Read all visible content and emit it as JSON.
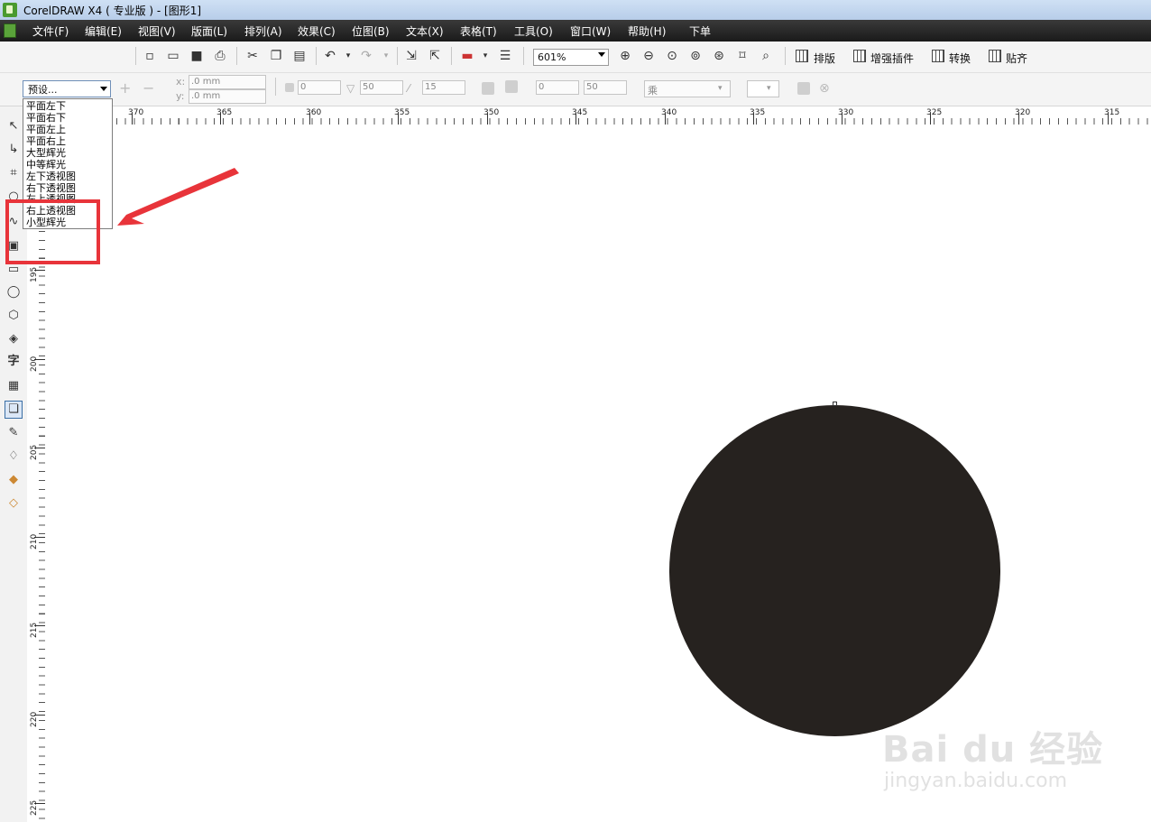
{
  "window": {
    "title": "CorelDRAW X4 ( 专业版 ) - [图形1]"
  },
  "menu": [
    "文件(F)",
    "编辑(E)",
    "视图(V)",
    "版面(L)",
    "排列(A)",
    "效果(C)",
    "位图(B)",
    "文本(X)",
    "表格(T)",
    "工具(O)",
    "窗口(W)",
    "帮助(H)",
    "下单"
  ],
  "toolbar": {
    "zoom": "601%",
    "buttons": [
      "排版",
      "增强插件",
      "转换",
      "贴齐"
    ]
  },
  "propbar": {
    "preset": "预设...",
    "x_label": "x:",
    "x_value": ".0 mm",
    "y_label": "y:",
    "y_value": ".0 mm",
    "shadow_offset": "0",
    "shadow_opacity": "50",
    "shadow_feather": "15",
    "fade": "0",
    "stretch": "50",
    "merge_mode": "乘"
  },
  "preset_list": [
    "平面左下",
    "平面右下",
    "平面左上",
    "平面右上",
    "大型辉光",
    "中等辉光",
    "左下透视图",
    "右下透视图",
    "左上透视图",
    "右上透视图",
    "小型辉光"
  ],
  "ruler": {
    "horizontal": [
      "370",
      "365",
      "360",
      "355",
      "350",
      "345",
      "340",
      "335",
      "330",
      "325",
      "320",
      "315"
    ],
    "vertical": [
      "195",
      "200",
      "205",
      "210",
      "215",
      "220",
      "225"
    ]
  },
  "colors": {
    "shape_fill": "#26221f",
    "annotation": "#e8343a"
  },
  "watermark": {
    "brand": "Bai du 经验",
    "url": "jingyan.baidu.com"
  }
}
